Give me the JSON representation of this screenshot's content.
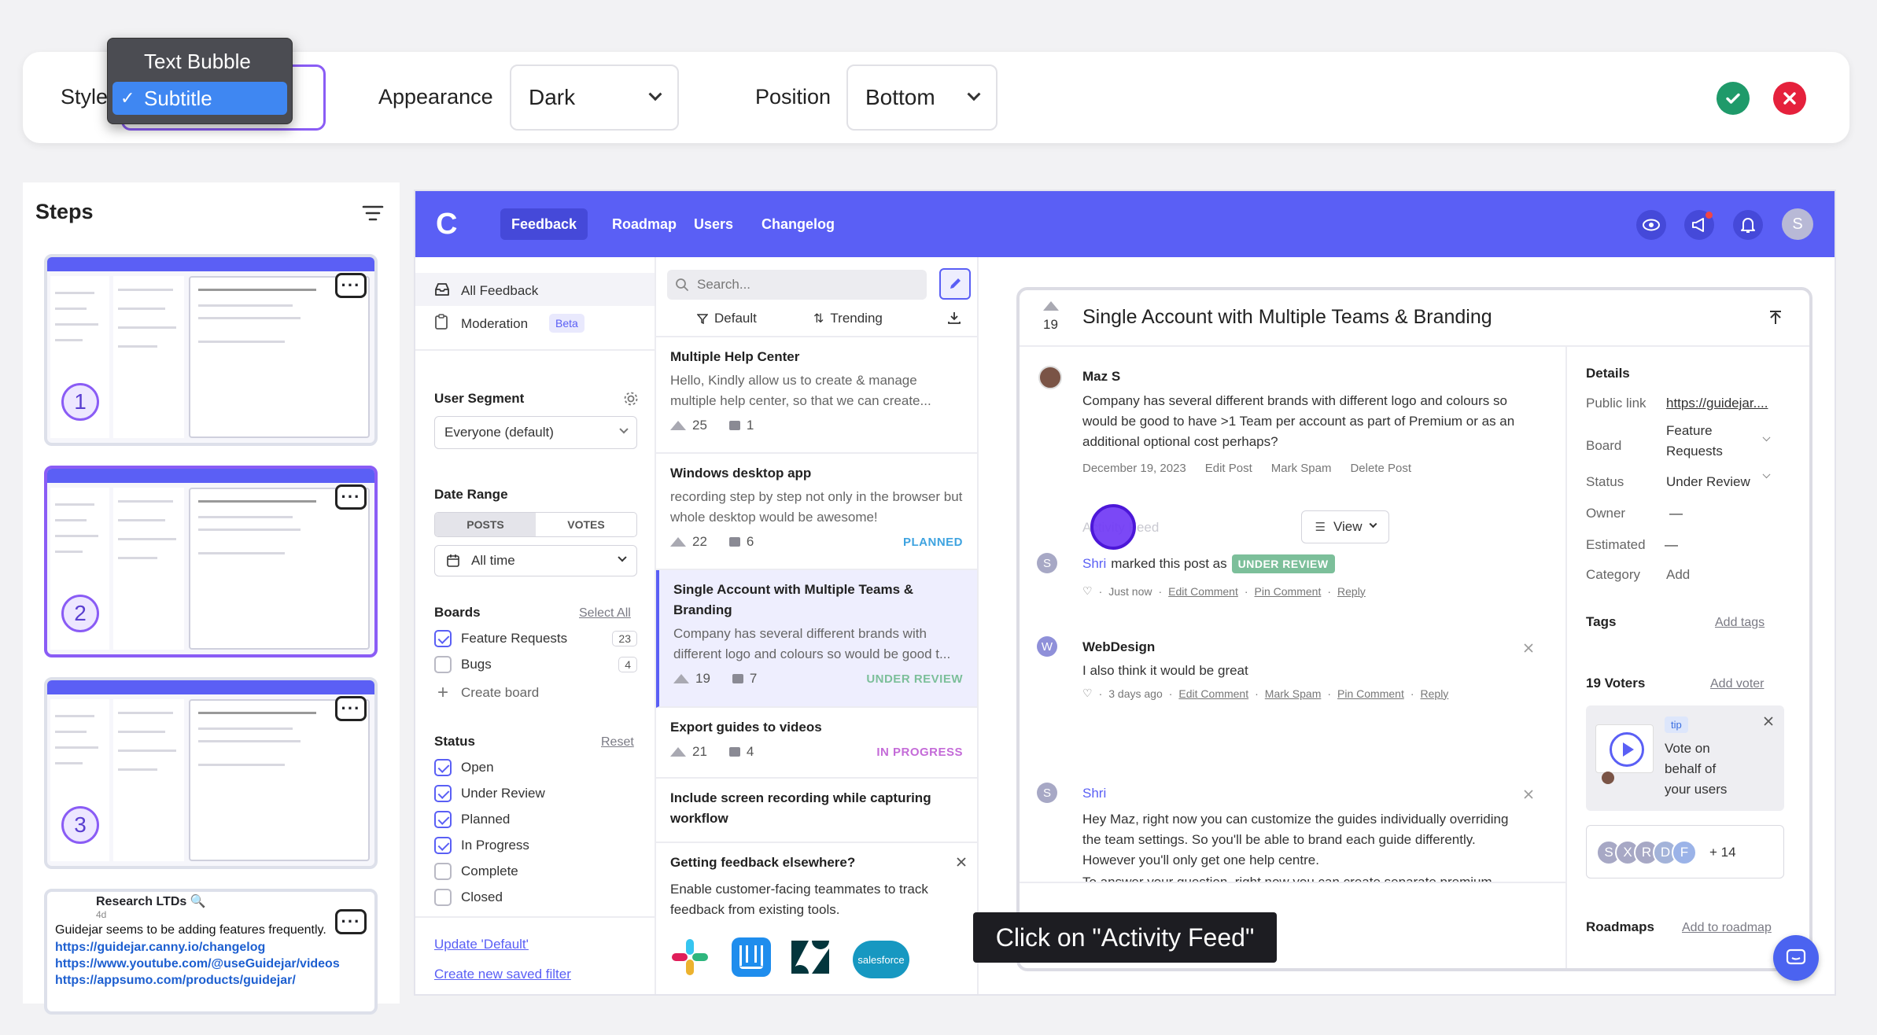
{
  "toolbar": {
    "style_label": "Style",
    "style_options": [
      "Text Bubble",
      "Subtitle"
    ],
    "style_selected": "Subtitle",
    "appearance_label": "Appearance",
    "appearance_value": "Dark",
    "position_label": "Position",
    "position_value": "Bottom",
    "checkmark": "✓"
  },
  "steps": {
    "title": "Steps",
    "items": [
      {
        "number": "1"
      },
      {
        "number": "2"
      },
      {
        "number": "3"
      }
    ],
    "more": "···",
    "note": {
      "title": "Research LTDs 🔍",
      "meta": "4d",
      "text": "Guidejar seems to be adding features frequently.",
      "links": [
        "https://guidejar.canny.io/changelog",
        "https://www.youtube.com/@useGuidejar/videos",
        "https://appsumo.com/products/guidejar/"
      ]
    }
  },
  "app": {
    "logo": "C",
    "nav": [
      "Feedback",
      "Roadmap",
      "Users",
      "Changelog"
    ],
    "avatar": "S",
    "sidebar": {
      "all_feedback": "All Feedback",
      "moderation": "Moderation",
      "beta": "Beta",
      "user_segment": "User Segment",
      "segment_value": "Everyone (default)",
      "date_range": "Date Range",
      "posts": "POSTS",
      "votes": "VOTES",
      "all_time": "All time",
      "boards": "Boards",
      "select_all": "Select All",
      "board_items": [
        {
          "label": "Feature Requests",
          "count": "23"
        },
        {
          "label": "Bugs",
          "count": "4"
        }
      ],
      "create_board": "Create board",
      "status": "Status",
      "reset": "Reset",
      "status_items": [
        {
          "label": "Open",
          "checked": true
        },
        {
          "label": "Under Review",
          "checked": true
        },
        {
          "label": "Planned",
          "checked": true
        },
        {
          "label": "In Progress",
          "checked": true
        },
        {
          "label": "Complete",
          "checked": false
        },
        {
          "label": "Closed",
          "checked": false
        }
      ],
      "update_default": "Update 'Default'",
      "create_filter": "Create new saved filter"
    },
    "list": {
      "search_placeholder": "Search...",
      "sort_default": "Default",
      "sort_trending": "Trending",
      "posts": [
        {
          "title": "Multiple Help Center",
          "desc": "Hello, Kindly allow us to create & manage multiple help center, so that we can create...",
          "votes": "25",
          "comments": "1",
          "status": "",
          "color": ""
        },
        {
          "title": "Windows desktop app",
          "desc": "recording step by step not only in the browser but whole desktop would be awesome!",
          "votes": "22",
          "comments": "6",
          "status": "PLANNED",
          "color": "#3ea3e0"
        },
        {
          "title": "Single Account with Multiple Teams & Branding",
          "desc": "Company has several different brands with different logo and colours so would be good t...",
          "votes": "19",
          "comments": "7",
          "status": "UNDER REVIEW",
          "color": "#7cbf9a"
        },
        {
          "title": "Export guides to videos",
          "desc": "",
          "votes": "21",
          "comments": "4",
          "status": "IN PROGRESS",
          "color": "#c46bd8"
        },
        {
          "title": "Include screen recording while capturing workflow",
          "desc": "",
          "votes": "",
          "comments": "",
          "status": "",
          "color": ""
        }
      ],
      "promo_title": "Getting feedback elsewhere?",
      "promo_text": "Enable customer-facing teammates to track feedback from existing tools."
    },
    "detail": {
      "votes": "19",
      "title": "Single Account with Multiple Teams & Branding",
      "author": "Maz S",
      "body": "Company has several different brands with different logo and colours so would be good to have >1 Team per account as part of Premium or as an additional optional cost perhaps?",
      "date": "December 19, 2023",
      "actions": [
        "Edit Post",
        "Mark Spam",
        "Delete Post"
      ],
      "activity_feed": "Activity Feed",
      "view": "View",
      "activity": [
        {
          "name": "Shri",
          "text": "marked this post as",
          "badge": "UNDER REVIEW",
          "meta": "Just now",
          "links": [
            "Edit Comment",
            "Pin Comment",
            "Reply"
          ]
        }
      ],
      "comments": [
        {
          "initial": "W",
          "name": "WebDesign",
          "text": "I also think it would be great",
          "meta": "3 days ago",
          "links": [
            "Edit Comment",
            "Mark Spam",
            "Pin Comment",
            "Reply"
          ]
        },
        {
          "initial": "S",
          "name": "Shri",
          "text": "Hey Maz, right now you can customize the guides individually overriding the team settings. So you'll be able to brand each guide differently. However you'll only get one help centre.",
          "meta": "",
          "links": []
        }
      ],
      "cut_text": "To answer your question, right now you can create separate premium",
      "details_title": "Details",
      "public_link_label": "Public link",
      "public_link_value": "https://guidejar....",
      "board_label": "Board",
      "board_value": "Feature Requests",
      "status_label": "Status",
      "status_value": "Under Review",
      "owner_label": "Owner",
      "owner_value": "—",
      "estimated_label": "Estimated",
      "estimated_value": "—",
      "category_label": "Category",
      "category_value": "Add",
      "tags_label": "Tags",
      "add_tags": "Add tags",
      "voters_label": "19 Voters",
      "add_voter": "Add voter",
      "tip_badge": "tip",
      "tip_text": "Vote on behalf of your users",
      "voter_initials": [
        "S",
        "X",
        "R",
        "D",
        "F"
      ],
      "voter_more": "+ 14",
      "roadmaps_label": "Roadmaps",
      "add_roadmap": "Add to roadmap"
    }
  },
  "caption": "Click on \"Activity Feed\"",
  "colors": {
    "brand": "#5a5ff5",
    "accent": "#8a5cf5",
    "confirm": "#1f9a6a",
    "cancel": "#e5213c"
  }
}
